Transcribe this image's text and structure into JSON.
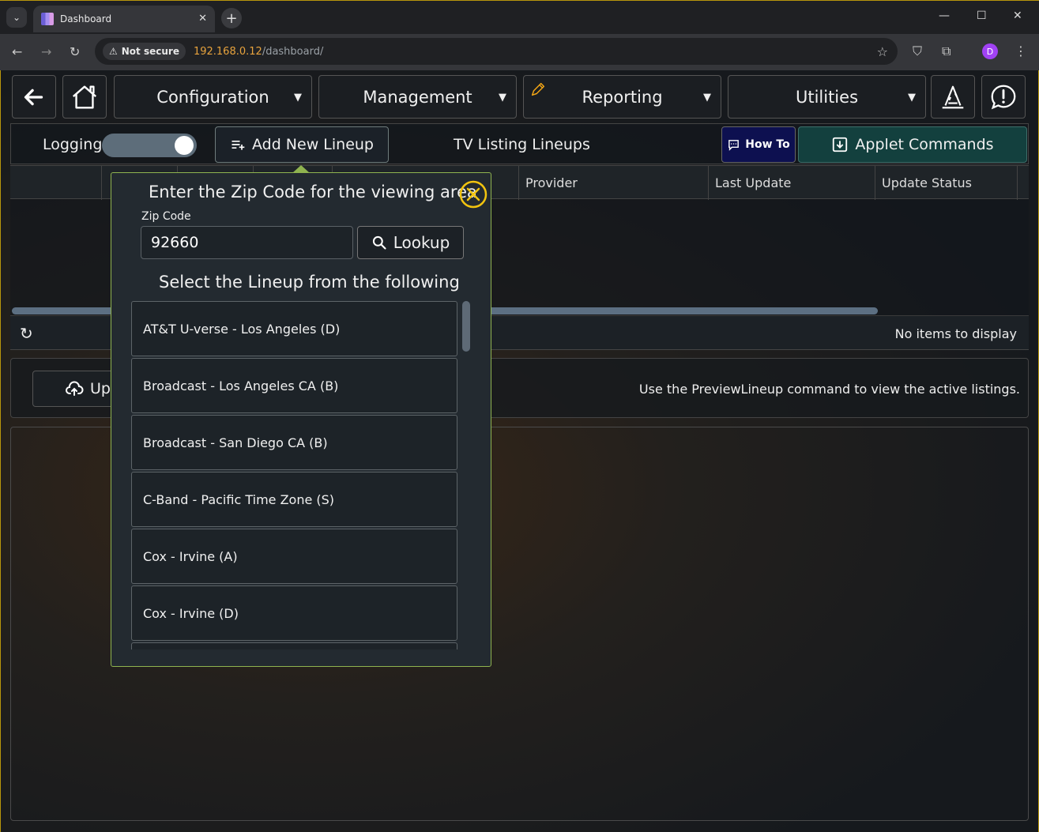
{
  "browser": {
    "tab_title": "Dashboard",
    "tab_close": "✕",
    "new_tab": "+",
    "security_label": "Not secure",
    "url_host": "192.168.0.12",
    "url_path": "/dashboard/",
    "profile_initial": "D"
  },
  "nav": {
    "configuration": "Configuration",
    "management": "Management",
    "reporting": "Reporting",
    "utilities": "Utilities"
  },
  "subbar": {
    "logging_label": "Logging",
    "logging_on": true,
    "add_lineup": "Add New Lineup",
    "title": "TV Listing Lineups",
    "howto": "How To",
    "applet_commands": "Applet Commands"
  },
  "grid": {
    "columns": [
      "",
      "",
      "",
      "",
      "Provider",
      "Last Update",
      "Update Status"
    ],
    "empty_message": "No items to display"
  },
  "actions": {
    "upload_label": "Up",
    "hint": "Use the PreviewLineup command to view the active listings."
  },
  "popover": {
    "title": "Enter the Zip Code for the viewing area",
    "zip_label": "Zip Code",
    "zip_value": "92660",
    "lookup": "Lookup",
    "select_title": "Select the Lineup from the following",
    "lineups": [
      "AT&T U-verse - Los Angeles (D)",
      "Broadcast - Los Angeles CA (B)",
      "Broadcast - San Diego CA (B)",
      "C-Band - Pacific Time Zone (S)",
      "Cox - Irvine (A)",
      "Cox - Irvine (D)",
      ""
    ]
  },
  "colors": {
    "accent_gold": "#b8960c",
    "popover_border": "#8fb34f",
    "close_icon": "#f2c40f",
    "howto_bg": "#0d1050",
    "applet_bg": "#13403e"
  }
}
